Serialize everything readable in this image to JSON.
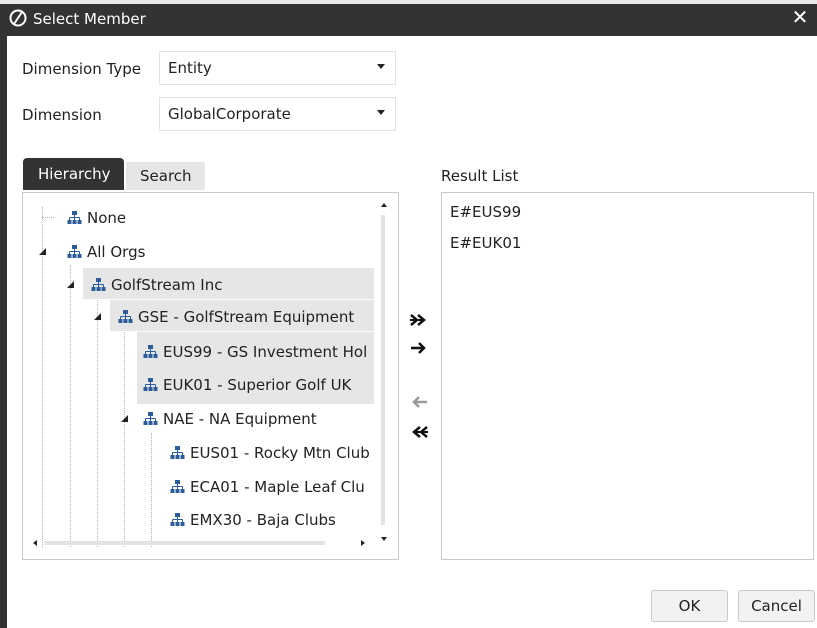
{
  "window": {
    "title": "Select Member",
    "close_symbol": "✕"
  },
  "dimension_type": {
    "label": "Dimension Type",
    "value": "Entity"
  },
  "dimension": {
    "label": "Dimension",
    "value": "GlobalCorporate"
  },
  "tabs": [
    {
      "label": "Hierarchy",
      "active": true
    },
    {
      "label": "Search",
      "active": false
    }
  ],
  "tree": {
    "nodes": [
      {
        "label": "None",
        "level": 0,
        "expanded": null,
        "selected": false
      },
      {
        "label": "All Orgs",
        "level": 0,
        "expanded": true,
        "selected": false
      },
      {
        "label": "GolfStream Inc",
        "level": 1,
        "expanded": true,
        "selected": true
      },
      {
        "label": "GSE - GolfStream Equipment",
        "level": 2,
        "expanded": true,
        "selected": true
      },
      {
        "label": "EUS99 - GS Investment Hol",
        "level": 3,
        "expanded": null,
        "selected": true
      },
      {
        "label": "EUK01 - Superior Golf UK",
        "level": 3,
        "expanded": null,
        "selected": true
      },
      {
        "label": "NAE - NA Equipment",
        "level": 3,
        "expanded": true,
        "selected": false
      },
      {
        "label": "EUS01 - Rocky Mtn Club",
        "level": 4,
        "expanded": null,
        "selected": false
      },
      {
        "label": "ECA01 - Maple Leaf Clu",
        "level": 4,
        "expanded": null,
        "selected": false
      },
      {
        "label": "EMX30 - Baja Clubs",
        "level": 4,
        "expanded": null,
        "selected": false
      }
    ]
  },
  "move_buttons": {
    "add_all": "»",
    "add": "→",
    "remove": "←",
    "remove_all": "«"
  },
  "result_list": {
    "label": "Result List",
    "items": [
      "E#EUS99",
      "E#EUK01"
    ]
  },
  "footer": {
    "ok": "OK",
    "cancel": "Cancel"
  },
  "colors": {
    "title_bar": "#333333",
    "icon_blue": "#2b5d9b",
    "selection": "#e6e6e6"
  }
}
